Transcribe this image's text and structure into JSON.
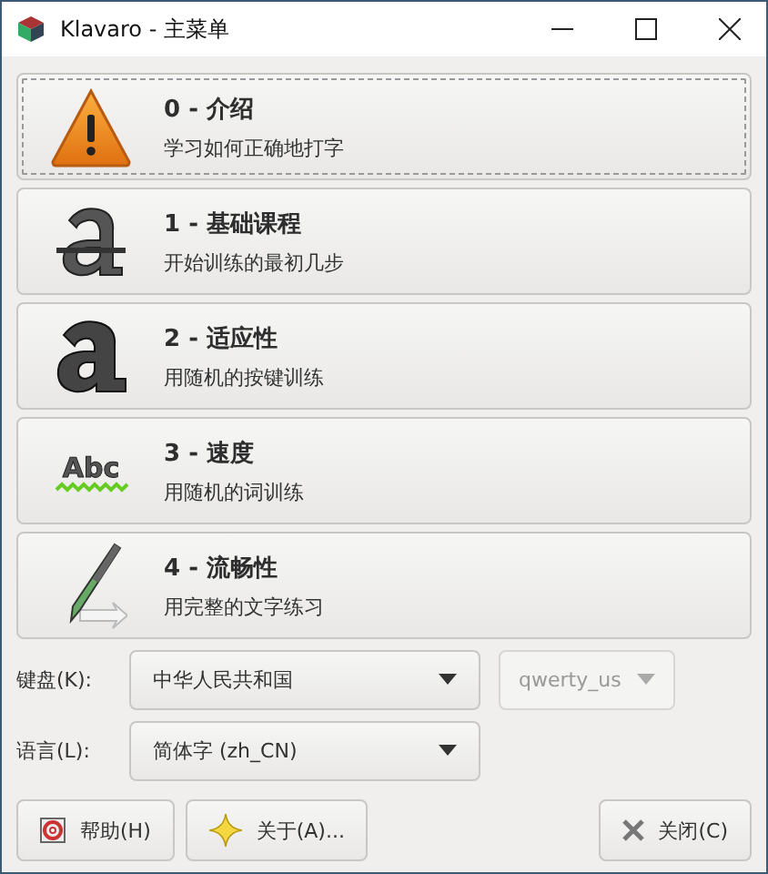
{
  "window": {
    "title": "Klavaro - 主菜单"
  },
  "lessons": [
    {
      "kind": "warning",
      "title": "0 - 介绍",
      "subtitle": "学习如何正确地打字",
      "focused": true
    },
    {
      "kind": "strike-a",
      "title": "1 - 基础课程",
      "subtitle": "开始训练的最初几步",
      "focused": false
    },
    {
      "kind": "bold-a",
      "title": "2 - 适应性",
      "subtitle": "用随机的按键训练",
      "focused": false
    },
    {
      "kind": "abc",
      "icon_text": "Abc",
      "title": "3 - 速度",
      "subtitle": "用随机的词训练",
      "focused": false
    },
    {
      "kind": "pen",
      "title": "4 - 流畅性",
      "subtitle": "用完整的文字练习",
      "focused": false
    }
  ],
  "keyboard": {
    "label": "键盘(K):",
    "value": "中华人民共和国",
    "layout": {
      "value": "qwerty_us",
      "disabled": true
    }
  },
  "language": {
    "label": "语言(L):",
    "value": "简体字 (zh_CN)"
  },
  "buttons": [
    {
      "kind": "help",
      "label": "帮助(H)"
    },
    {
      "kind": "about",
      "label": "关于(A)..."
    },
    {
      "kind": "close",
      "label": "关闭(C)"
    }
  ]
}
